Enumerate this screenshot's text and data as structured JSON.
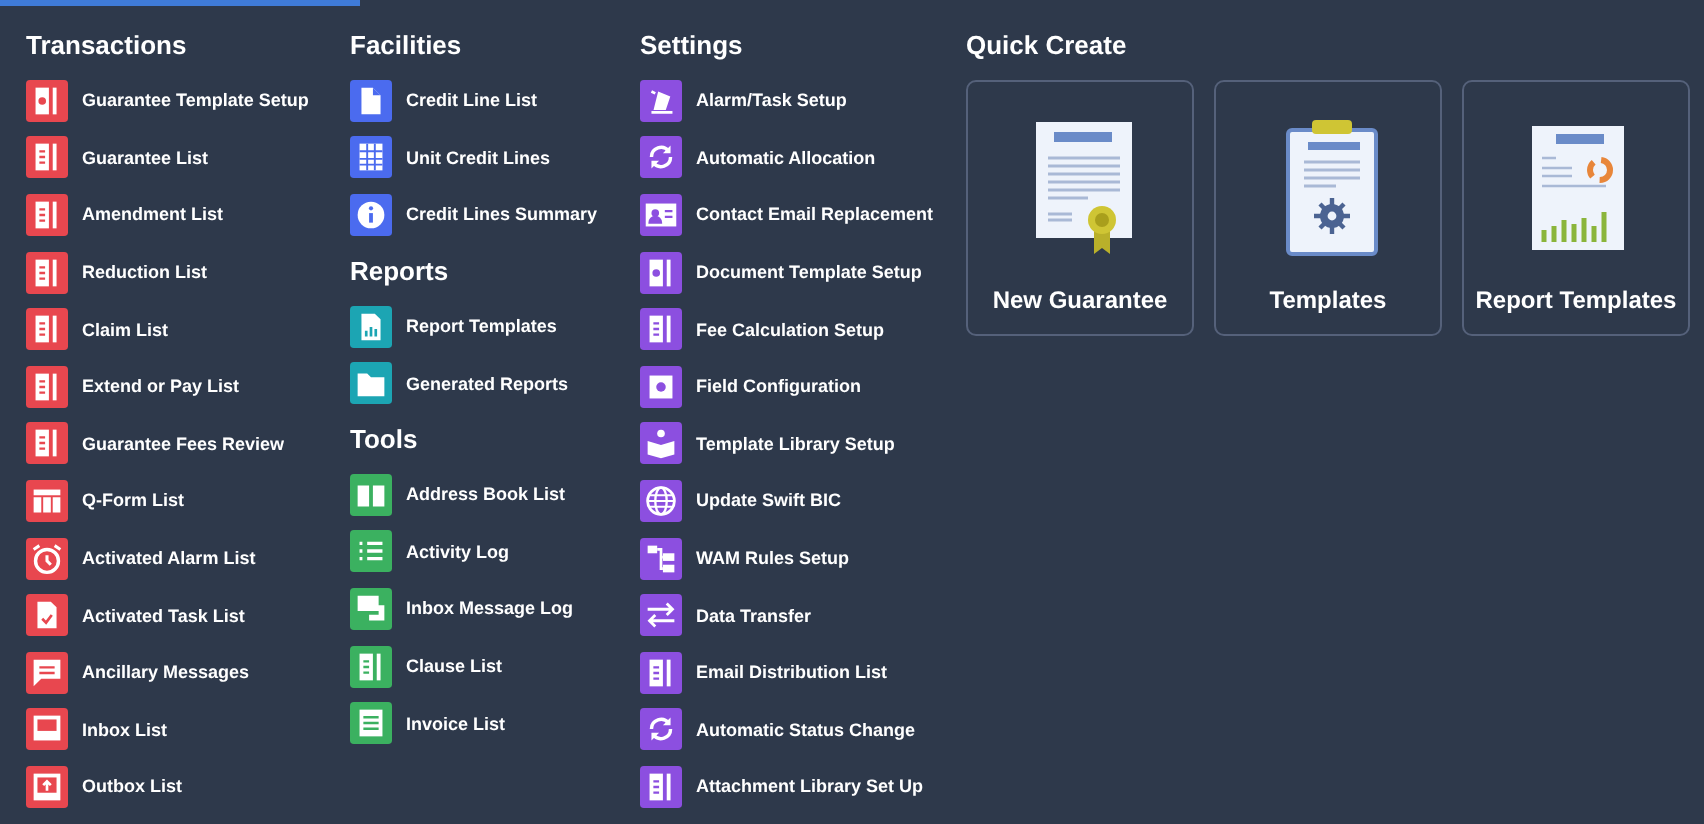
{
  "columns": [
    {
      "sections": [
        {
          "title": "Transactions",
          "color": "#e8474f",
          "items": [
            {
              "label": "Guarantee Template Setup",
              "kind": "gear-doc"
            },
            {
              "label": "Guarantee List",
              "kind": "doc"
            },
            {
              "label": "Amendment List",
              "kind": "doc"
            },
            {
              "label": "Reduction List",
              "kind": "doc"
            },
            {
              "label": "Claim List",
              "kind": "doc"
            },
            {
              "label": "Extend or Pay List",
              "kind": "doc"
            },
            {
              "label": "Guarantee Fees Review",
              "kind": "doc"
            },
            {
              "label": "Q-Form List",
              "kind": "table"
            },
            {
              "label": "Activated Alarm List",
              "kind": "alarm"
            },
            {
              "label": "Activated Task List",
              "kind": "task"
            },
            {
              "label": "Ancillary Messages",
              "kind": "message"
            },
            {
              "label": "Inbox List",
              "kind": "inbox"
            },
            {
              "label": "Outbox List",
              "kind": "outbox"
            }
          ]
        }
      ]
    },
    {
      "sections": [
        {
          "title": "Facilities",
          "color": "#4b6bef",
          "items": [
            {
              "label": "Credit Line List",
              "kind": "file"
            },
            {
              "label": "Unit Credit Lines",
              "kind": "grid"
            },
            {
              "label": "Credit Lines Summary",
              "kind": "info"
            }
          ]
        },
        {
          "title": "Reports",
          "color": "#1ca5b3",
          "items": [
            {
              "label": "Report Templates",
              "kind": "chart"
            },
            {
              "label": "Generated Reports",
              "kind": "folder"
            }
          ]
        },
        {
          "title": "Tools",
          "color": "#3bb160",
          "items": [
            {
              "label": "Address Book List",
              "kind": "book"
            },
            {
              "label": "Activity Log",
              "kind": "list"
            },
            {
              "label": "Inbox Message Log",
              "kind": "chat"
            },
            {
              "label": "Clause List",
              "kind": "doc"
            },
            {
              "label": "Invoice List",
              "kind": "lines"
            }
          ]
        }
      ]
    },
    {
      "sections": [
        {
          "title": "Settings",
          "color": "#8c4fe0",
          "items": [
            {
              "label": "Alarm/Task Setup",
              "kind": "bell"
            },
            {
              "label": "Automatic Allocation",
              "kind": "sync"
            },
            {
              "label": "Contact Email Replacement",
              "kind": "contact"
            },
            {
              "label": "Document Template Setup",
              "kind": "gear-doc"
            },
            {
              "label": "Fee Calculation Setup",
              "kind": "doc"
            },
            {
              "label": "Field Configuration",
              "kind": "gear"
            },
            {
              "label": "Template Library Setup",
              "kind": "reader"
            },
            {
              "label": "Update Swift BIC",
              "kind": "globe"
            },
            {
              "label": "WAM Rules Setup",
              "kind": "tree"
            },
            {
              "label": "Data Transfer",
              "kind": "transfer"
            },
            {
              "label": "Email Distribution List",
              "kind": "doc"
            },
            {
              "label": "Automatic Status Change",
              "kind": "sync"
            },
            {
              "label": "Attachment Library Set Up",
              "kind": "doc"
            }
          ]
        }
      ]
    }
  ],
  "quick_create": {
    "title": "Quick Create",
    "cards": [
      {
        "label": "New Guarantee",
        "kind": "certificate"
      },
      {
        "label": "Templates",
        "kind": "clipboard"
      },
      {
        "label": "Report Templates",
        "kind": "report"
      }
    ]
  }
}
